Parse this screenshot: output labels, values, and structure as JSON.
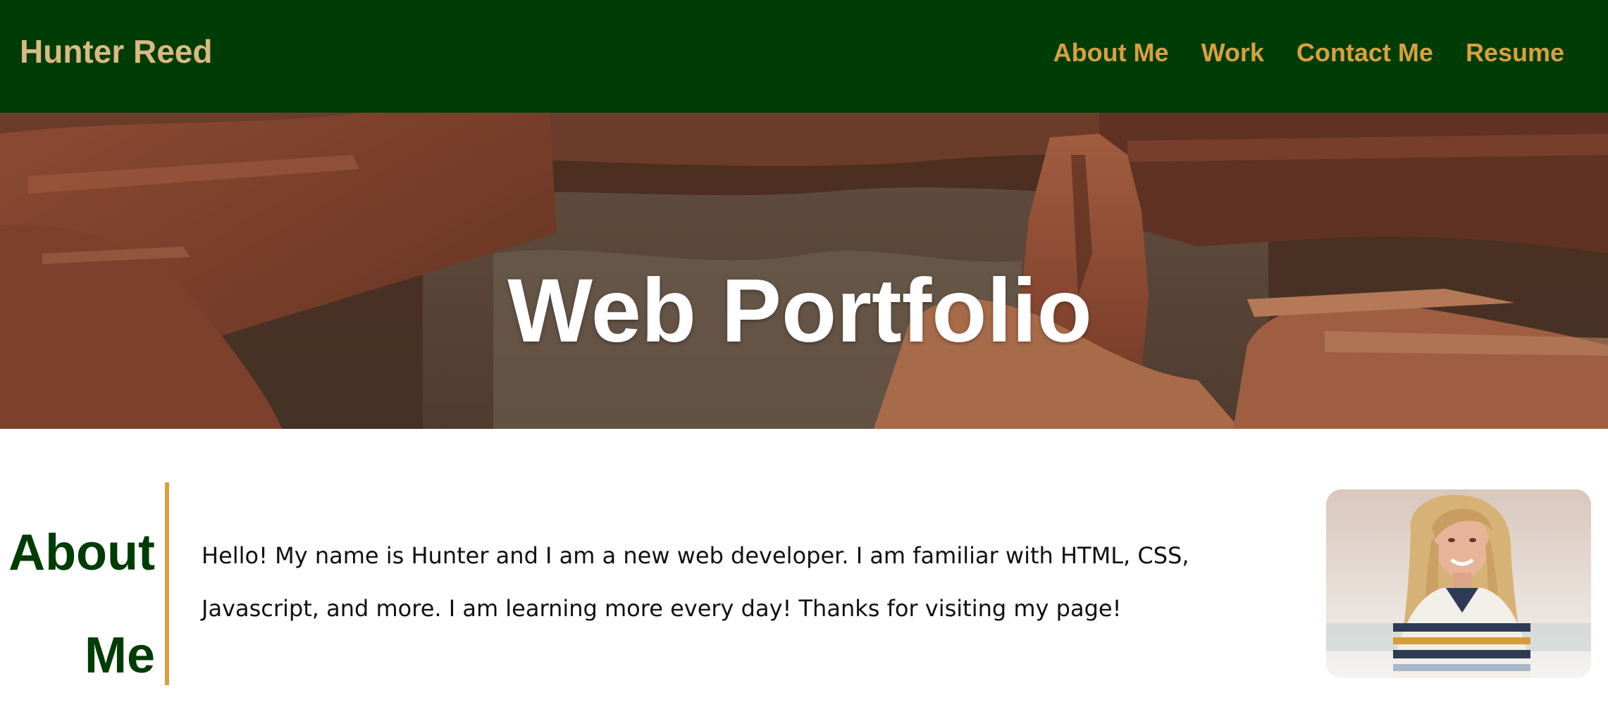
{
  "header": {
    "site_name": "Hunter Reed",
    "nav": [
      {
        "label": "About Me"
      },
      {
        "label": "Work"
      },
      {
        "label": "Contact Me"
      },
      {
        "label": "Resume"
      }
    ]
  },
  "hero": {
    "title": "Web Portfolio",
    "background": "canyon-photo"
  },
  "about": {
    "heading": "About Me",
    "text": "Hello! My name is Hunter and I am a new web developer. I am familiar with HTML, CSS, Javascript, and more. I am learning more every day! Thanks for visiting my page!",
    "photo": "portrait-photo"
  },
  "colors": {
    "header_bg": "#003c06",
    "site_name": "#d9b983",
    "nav_link": "#d8a03f",
    "accent": "#d8a03f",
    "heading": "#003c06"
  }
}
